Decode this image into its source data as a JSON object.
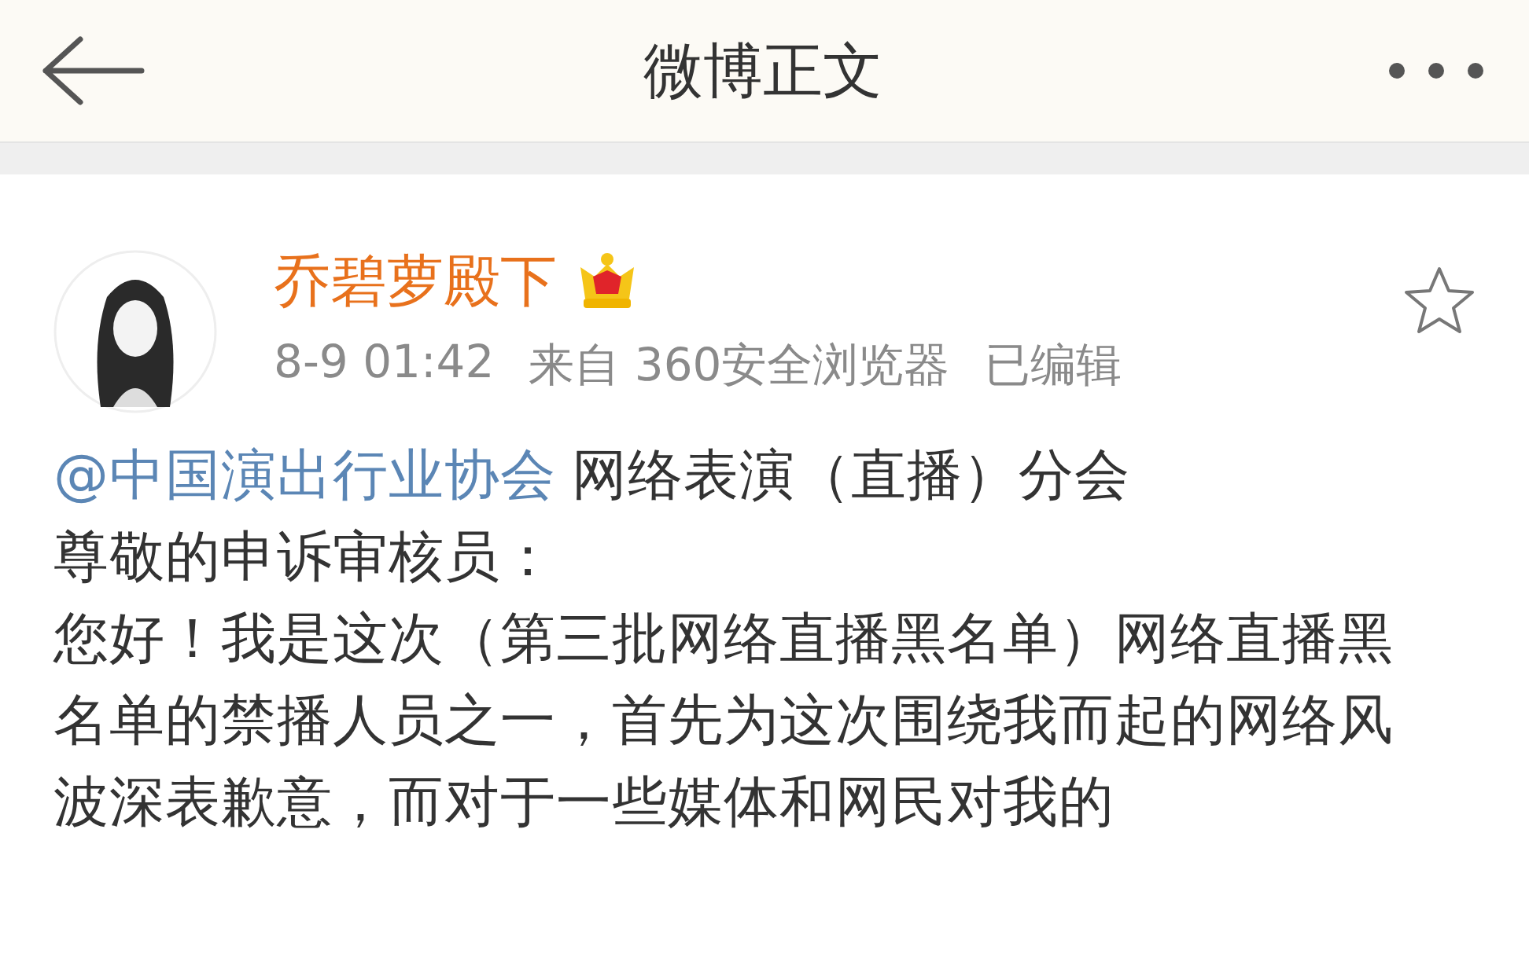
{
  "header": {
    "title": "微博正文"
  },
  "post": {
    "author": "乔碧萝殿下",
    "time": "8-9 01:42",
    "source": "来自 360安全浏览器",
    "edited": "已编辑",
    "favorited": false,
    "paragraphs": [
      {
        "mention": "@中国演出行业协会",
        "text": "网络表演（直播）分会"
      },
      {
        "text": "尊敬的申诉审核员："
      },
      {
        "text": "您好！我是这次（第三批网络直播黑名单）网络直播黑名单的禁播人员之一，首先为这次围绕我而起的网络风波深表歉意，而对于一些媒体和网民对我的"
      }
    ]
  }
}
